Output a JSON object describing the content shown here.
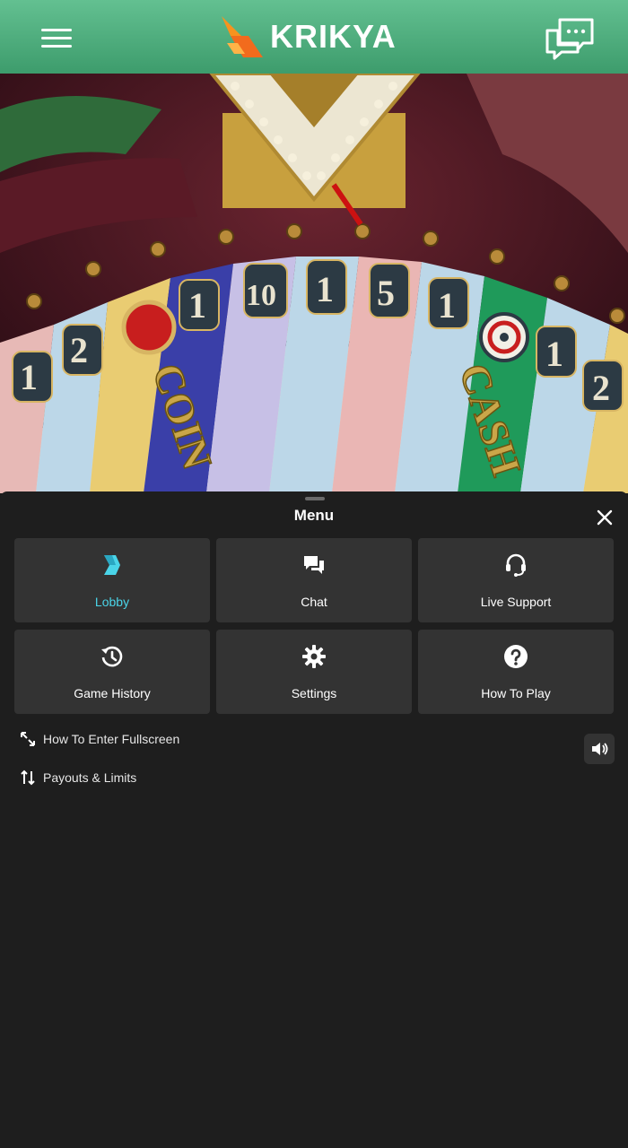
{
  "header": {
    "brand": "KRIKYA",
    "menu_icon": "hamburger-menu-icon",
    "chat_icon": "chat-bubbles-icon"
  },
  "game": {
    "wheel_numbers": [
      "1",
      "2",
      "1",
      "10",
      "1",
      "5",
      "1",
      "1",
      "2"
    ],
    "segment_labels": [
      "COIN",
      "CASH"
    ]
  },
  "menu": {
    "title": "Menu",
    "tiles": [
      {
        "label": "Lobby",
        "icon": "lobby-icon",
        "active": true
      },
      {
        "label": "Chat",
        "icon": "chat-icon"
      },
      {
        "label": "Live Support",
        "icon": "headset-icon"
      },
      {
        "label": "Game History",
        "icon": "history-icon"
      },
      {
        "label": "Settings",
        "icon": "gear-icon"
      },
      {
        "label": "How To Play",
        "icon": "question-icon"
      }
    ],
    "links": [
      {
        "label": "How To Enter Fullscreen",
        "icon": "expand-arrows-icon"
      },
      {
        "label": "Payouts & Limits",
        "icon": "up-down-arrows-icon"
      }
    ],
    "sound_icon": "speaker-icon"
  },
  "colors": {
    "header_green": "#4fae7e",
    "accent": "#4ad4e8",
    "panel_bg": "#1e1e1e",
    "tile_bg": "#333333",
    "logo_orange": "#f26b1d"
  }
}
